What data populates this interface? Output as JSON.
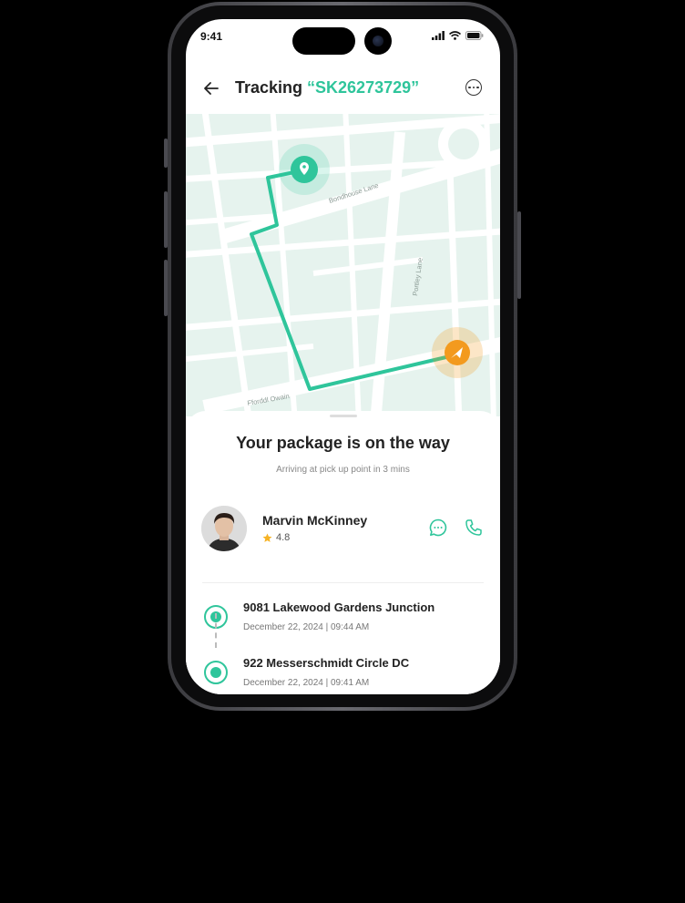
{
  "status_bar": {
    "time": "9:41"
  },
  "header": {
    "title_prefix": "Tracking ",
    "tracking_code": "“SK26273729”"
  },
  "map": {
    "street_labels": [
      "Bondhouse Lane",
      "Portley Lane",
      "Fforddl Owain"
    ],
    "route_color": "#2fc59b",
    "destination_color": "#2fc59b",
    "courier_color": "#f39a1e"
  },
  "sheet": {
    "title": "Your package is on the way",
    "subtitle": "Arriving at pick up point in 3 mins"
  },
  "driver": {
    "name": "Marvin McKinney",
    "rating": "4.8"
  },
  "stops": [
    {
      "address": "9081 Lakewood Gardens Junction",
      "datetime": "December 22, 2024 | 09:44 AM"
    },
    {
      "address": "922 Messerschmidt Circle  DC",
      "datetime": "December 22, 2024 | 09:41 AM"
    }
  ],
  "colors": {
    "accent": "#2fc59b",
    "courier": "#f39a1e"
  }
}
